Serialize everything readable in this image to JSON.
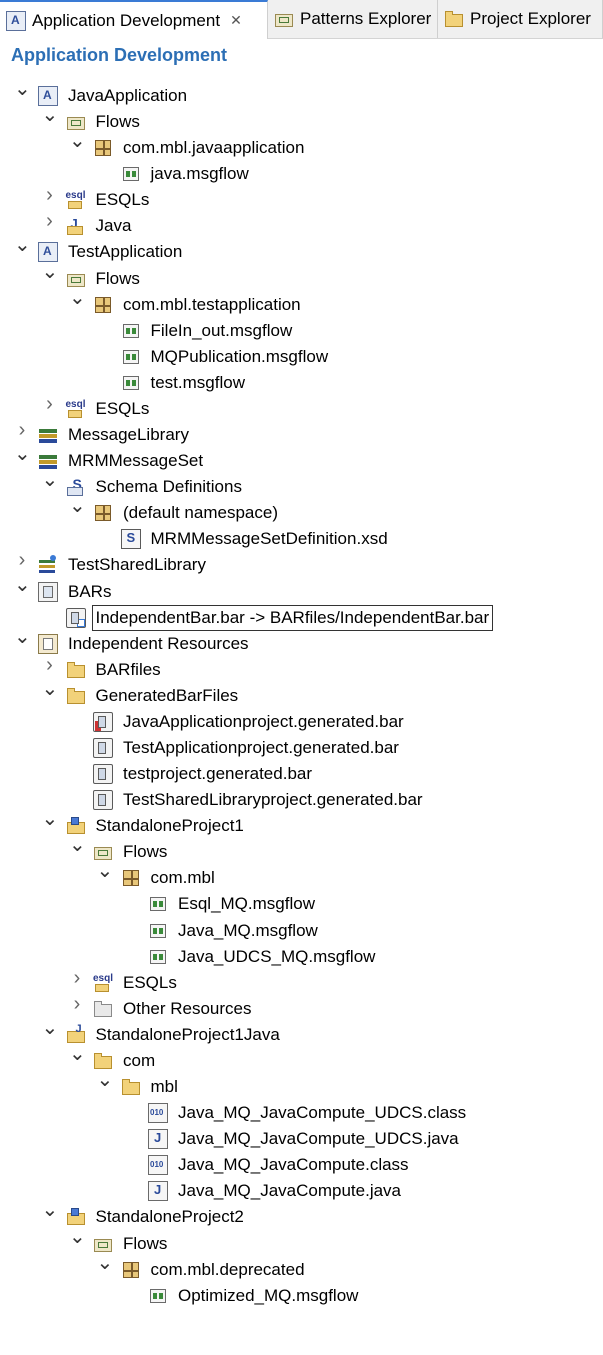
{
  "tabs": [
    {
      "label": "Application Development",
      "icon": "app-dev-icon",
      "active": true,
      "closable": true
    },
    {
      "label": "Patterns Explorer",
      "icon": "patterns-icon",
      "active": false,
      "closable": false
    },
    {
      "label": "Project Explorer",
      "icon": "project-explorer-icon",
      "active": false,
      "closable": false
    }
  ],
  "view": {
    "title": "Application Development"
  },
  "tree": [
    {
      "label": "JavaApplication",
      "icon": "application-icon",
      "depth": 0,
      "expander": "expanded"
    },
    {
      "label": "Flows",
      "icon": "flows-folder-icon",
      "depth": 1,
      "expander": "expanded"
    },
    {
      "label": "com.mbl.javaapplication",
      "icon": "package-icon",
      "depth": 2,
      "expander": "expanded"
    },
    {
      "label": "java.msgflow",
      "icon": "msgflow-icon",
      "depth": 3,
      "expander": "none"
    },
    {
      "label": "ESQLs",
      "icon": "esql-folder-icon",
      "depth": 1,
      "expander": "collapsed"
    },
    {
      "label": "Java",
      "icon": "java-folder-icon",
      "depth": 1,
      "expander": "collapsed"
    },
    {
      "label": "TestApplication",
      "icon": "application-icon",
      "depth": 0,
      "expander": "expanded"
    },
    {
      "label": "Flows",
      "icon": "flows-folder-icon",
      "depth": 1,
      "expander": "expanded"
    },
    {
      "label": "com.mbl.testapplication",
      "icon": "package-icon",
      "depth": 2,
      "expander": "expanded"
    },
    {
      "label": "FileIn_out.msgflow",
      "icon": "msgflow-icon",
      "depth": 3,
      "expander": "none"
    },
    {
      "label": "MQPublication.msgflow",
      "icon": "msgflow-icon",
      "depth": 3,
      "expander": "none"
    },
    {
      "label": "test.msgflow",
      "icon": "msgflow-icon",
      "depth": 3,
      "expander": "none"
    },
    {
      "label": "ESQLs",
      "icon": "esql-folder-icon",
      "depth": 1,
      "expander": "collapsed"
    },
    {
      "label": "MessageLibrary",
      "icon": "library-icon",
      "depth": 0,
      "expander": "collapsed"
    },
    {
      "label": "MRMMessageSet",
      "icon": "library-icon",
      "depth": 0,
      "expander": "expanded"
    },
    {
      "label": "Schema Definitions",
      "icon": "schema-folder-icon",
      "depth": 1,
      "expander": "expanded"
    },
    {
      "label": "(default namespace)",
      "icon": "package-icon",
      "depth": 2,
      "expander": "expanded"
    },
    {
      "label": "MRMMessageSetDefinition.xsd",
      "icon": "xsd-file-icon",
      "depth": 3,
      "expander": "none"
    },
    {
      "label": "TestSharedLibrary",
      "icon": "shared-library-icon",
      "depth": 0,
      "expander": "collapsed"
    },
    {
      "label": "BARs",
      "icon": "bars-icon",
      "depth": 0,
      "expander": "expanded"
    },
    {
      "label": "IndependentBar.bar -> BARfiles/IndependentBar.bar",
      "icon": "bar-link-icon",
      "depth": 1,
      "expander": "none",
      "selected": true
    },
    {
      "label": "Independent Resources",
      "icon": "independent-resources-icon",
      "depth": 0,
      "expander": "expanded"
    },
    {
      "label": "BARfiles",
      "icon": "folder-icon",
      "depth": 1,
      "expander": "collapsed"
    },
    {
      "label": "GeneratedBarFiles",
      "icon": "folder-icon",
      "depth": 1,
      "expander": "expanded"
    },
    {
      "label": "JavaApplicationproject.generated.bar",
      "icon": "bar-generated-icon",
      "depth": 2,
      "expander": "none"
    },
    {
      "label": "TestApplicationproject.generated.bar",
      "icon": "bar-file-icon",
      "depth": 2,
      "expander": "none"
    },
    {
      "label": "testproject.generated.bar",
      "icon": "bar-file-icon",
      "depth": 2,
      "expander": "none"
    },
    {
      "label": "TestSharedLibraryproject.generated.bar",
      "icon": "bar-file-icon",
      "depth": 2,
      "expander": "none"
    },
    {
      "label": "StandaloneProject1",
      "icon": "project-icon",
      "depth": 1,
      "expander": "expanded"
    },
    {
      "label": "Flows",
      "icon": "flows-folder-icon",
      "depth": 2,
      "expander": "expanded"
    },
    {
      "label": "com.mbl",
      "icon": "package-icon",
      "depth": 3,
      "expander": "expanded"
    },
    {
      "label": "Esql_MQ.msgflow",
      "icon": "msgflow-icon",
      "depth": 4,
      "expander": "none"
    },
    {
      "label": "Java_MQ.msgflow",
      "icon": "msgflow-icon",
      "depth": 4,
      "expander": "none"
    },
    {
      "label": "Java_UDCS_MQ.msgflow",
      "icon": "msgflow-icon",
      "depth": 4,
      "expander": "none"
    },
    {
      "label": "ESQLs",
      "icon": "esql-folder-icon",
      "depth": 2,
      "expander": "collapsed"
    },
    {
      "label": "Other Resources",
      "icon": "other-resources-icon",
      "depth": 2,
      "expander": "collapsed"
    },
    {
      "label": "StandaloneProject1Java",
      "icon": "java-project-icon",
      "depth": 1,
      "expander": "expanded"
    },
    {
      "label": "com",
      "icon": "folder-icon",
      "depth": 2,
      "expander": "expanded"
    },
    {
      "label": "mbl",
      "icon": "folder-icon",
      "depth": 3,
      "expander": "expanded"
    },
    {
      "label": "Java_MQ_JavaCompute_UDCS.class",
      "icon": "class-file-icon",
      "depth": 4,
      "expander": "none"
    },
    {
      "label": "Java_MQ_JavaCompute_UDCS.java",
      "icon": "java-file-icon",
      "depth": 4,
      "expander": "none"
    },
    {
      "label": "Java_MQ_JavaCompute.class",
      "icon": "class-file-icon",
      "depth": 4,
      "expander": "none"
    },
    {
      "label": "Java_MQ_JavaCompute.java",
      "icon": "java-file-icon",
      "depth": 4,
      "expander": "none"
    },
    {
      "label": "StandaloneProject2",
      "icon": "project-icon",
      "depth": 1,
      "expander": "expanded"
    },
    {
      "label": "Flows",
      "icon": "flows-folder-icon",
      "depth": 2,
      "expander": "expanded"
    },
    {
      "label": "com.mbl.deprecated",
      "icon": "package-icon",
      "depth": 3,
      "expander": "expanded"
    },
    {
      "label": "Optimized_MQ.msgflow",
      "icon": "msgflow-icon",
      "depth": 4,
      "expander": "none"
    }
  ],
  "colors": {
    "accent": "#2c6fb5",
    "tab_active_border": "#3a7bd5"
  }
}
